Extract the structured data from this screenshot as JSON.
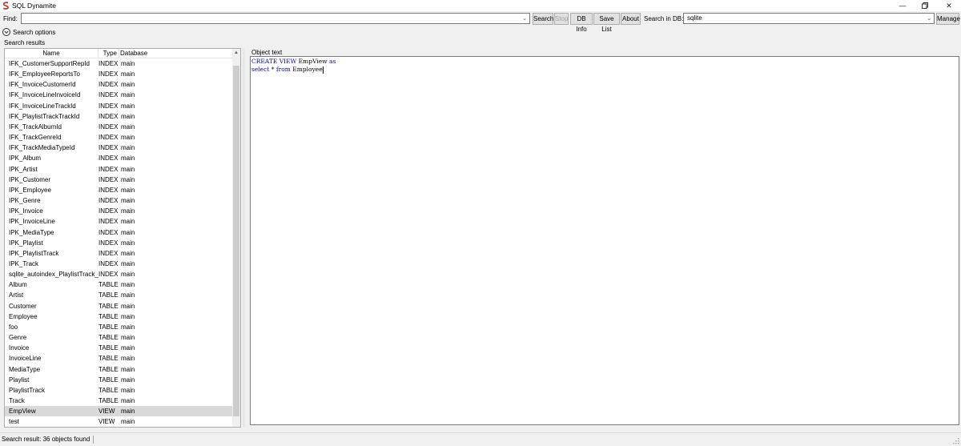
{
  "window": {
    "title": "SQL Dynamite",
    "minimize_icon": "minimize-icon",
    "maximize_icon": "restore-icon",
    "close_icon": "close-icon"
  },
  "toolbar": {
    "find_label": "Find:",
    "find_value": "",
    "search_label": "Search",
    "stop_label": "Stop",
    "dbinfo_label": "DB Info",
    "savelist_label": "Save List",
    "about_label": "About",
    "search_in_label": "Search in DB:",
    "db_value": "sqlite",
    "manage_label": "Manage"
  },
  "search_options": {
    "label": "Search options"
  },
  "results": {
    "label": "Search results",
    "columns": [
      "Name",
      "Type",
      "Database"
    ],
    "rows": [
      [
        "IFK_CustomerSupportRepId",
        "INDEX",
        "main"
      ],
      [
        "IFK_EmployeeReportsTo",
        "INDEX",
        "main"
      ],
      [
        "IFK_InvoiceCustomerId",
        "INDEX",
        "main"
      ],
      [
        "IFK_InvoiceLineInvoiceId",
        "INDEX",
        "main"
      ],
      [
        "IFK_InvoiceLineTrackId",
        "INDEX",
        "main"
      ],
      [
        "IFK_PlaylistTrackTrackId",
        "INDEX",
        "main"
      ],
      [
        "IFK_TrackAlbumId",
        "INDEX",
        "main"
      ],
      [
        "IFK_TrackGenreId",
        "INDEX",
        "main"
      ],
      [
        "IFK_TrackMediaTypeId",
        "INDEX",
        "main"
      ],
      [
        "IPK_Album",
        "INDEX",
        "main"
      ],
      [
        "IPK_Artist",
        "INDEX",
        "main"
      ],
      [
        "IPK_Customer",
        "INDEX",
        "main"
      ],
      [
        "IPK_Employee",
        "INDEX",
        "main"
      ],
      [
        "IPK_Genre",
        "INDEX",
        "main"
      ],
      [
        "IPK_Invoice",
        "INDEX",
        "main"
      ],
      [
        "IPK_InvoiceLine",
        "INDEX",
        "main"
      ],
      [
        "IPK_MediaType",
        "INDEX",
        "main"
      ],
      [
        "IPK_Playlist",
        "INDEX",
        "main"
      ],
      [
        "IPK_PlaylistTrack",
        "INDEX",
        "main"
      ],
      [
        "IPK_Track",
        "INDEX",
        "main"
      ],
      [
        "sqlite_autoindex_PlaylistTrack_1",
        "INDEX",
        "main"
      ],
      [
        "Album",
        "TABLE",
        "main"
      ],
      [
        "Artist",
        "TABLE",
        "main"
      ],
      [
        "Customer",
        "TABLE",
        "main"
      ],
      [
        "Employee",
        "TABLE",
        "main"
      ],
      [
        "foo",
        "TABLE",
        "main"
      ],
      [
        "Genre",
        "TABLE",
        "main"
      ],
      [
        "Invoice",
        "TABLE",
        "main"
      ],
      [
        "InvoiceLine",
        "TABLE",
        "main"
      ],
      [
        "MediaType",
        "TABLE",
        "main"
      ],
      [
        "Playlist",
        "TABLE",
        "main"
      ],
      [
        "PlaylistTrack",
        "TABLE",
        "main"
      ],
      [
        "Track",
        "TABLE",
        "main"
      ],
      [
        "EmpView",
        "VIEW",
        "main"
      ],
      [
        "test",
        "VIEW",
        "main"
      ]
    ],
    "selected_row": "EmpView"
  },
  "object": {
    "label": "Object text",
    "lines": [
      [
        {
          "t": "CREATE VIEW",
          "kw": true
        },
        {
          "t": " EmpView ",
          "kw": false
        },
        {
          "t": "as",
          "kw": true
        }
      ],
      [
        {
          "t": "select",
          "kw": true
        },
        {
          "t": " * ",
          "kw": false
        },
        {
          "t": "from",
          "kw": true
        },
        {
          "t": " Employee",
          "kw": false
        }
      ]
    ]
  },
  "status": {
    "text": "Search result:  36 objects found"
  },
  "colors": {
    "keyword": "#0000c0",
    "selected_row": "#d9d9d9",
    "logo_red": "#c0392b"
  }
}
